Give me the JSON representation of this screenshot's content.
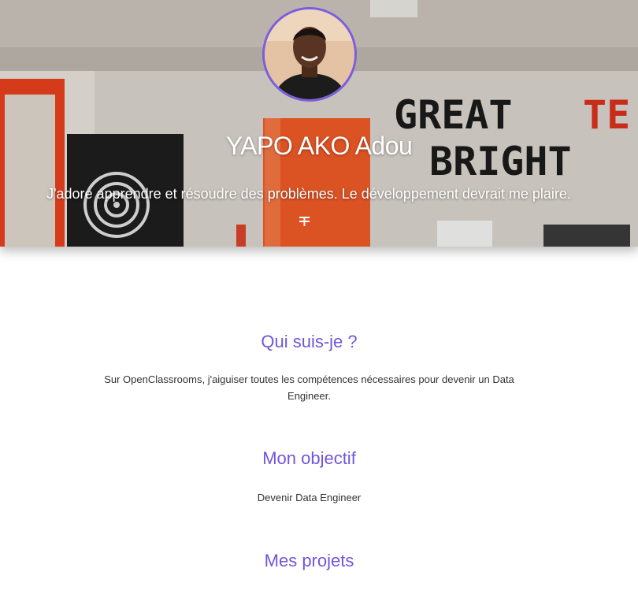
{
  "hero": {
    "name": "YAPO AKO Adou",
    "tagline": "J'adore apprendre et résoudre des problèmes. Le développement devrait me plaire.",
    "background_sign_line1": "GREAT",
    "background_sign_line1_accent": "TE",
    "background_sign_line2": "BRIGHT",
    "icon": "expand-arrows-icon"
  },
  "sections": {
    "about": {
      "title": "Qui suis-je ?",
      "text": "Sur OpenClassrooms, j'aiguiser toutes les compétences nécessaires pour devenir un Data Engineer."
    },
    "goal": {
      "title": "Mon objectif",
      "text": "Devenir Data Engineer"
    },
    "projects": {
      "title": "Mes projets"
    }
  },
  "colors": {
    "accent": "#7256d9",
    "avatar_border": "#7c5ce0",
    "text": "#333333"
  }
}
